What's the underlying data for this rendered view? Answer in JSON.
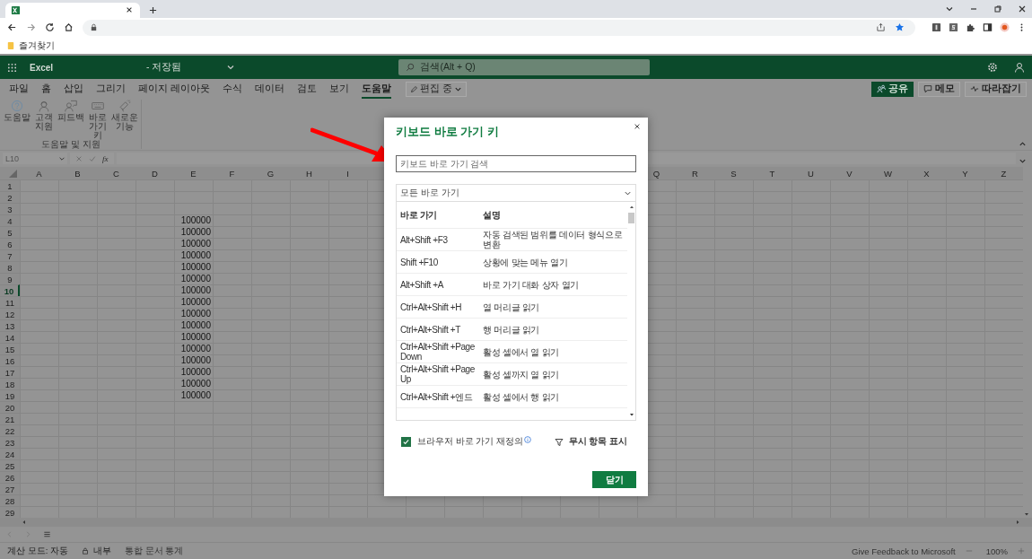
{
  "browser": {
    "bookmark": "즐겨찾기"
  },
  "app_bar": {
    "app_name": "Excel",
    "doc_status": "- 저장됨",
    "search_placeholder": "검색(Alt + Q)"
  },
  "ribbon_tabs": [
    {
      "label": "파일",
      "selected": false
    },
    {
      "label": "홈",
      "selected": false
    },
    {
      "label": "삽입",
      "selected": false
    },
    {
      "label": "그리기",
      "selected": false
    },
    {
      "label": "페이지 레이아웃",
      "selected": false
    },
    {
      "label": "수식",
      "selected": false
    },
    {
      "label": "데이터",
      "selected": false
    },
    {
      "label": "검토",
      "selected": false
    },
    {
      "label": "보기",
      "selected": false
    },
    {
      "label": "도움말",
      "selected": true
    }
  ],
  "editing_button": "편집 중",
  "right_buttons": [
    {
      "label": "공유",
      "kind": "share"
    },
    {
      "label": "메모",
      "kind": "comment"
    },
    {
      "label": "따라잡기",
      "kind": "catchup"
    }
  ],
  "ribbon_group": {
    "label": "도움말 및 지원",
    "buttons": [
      {
        "label": "도움말",
        "kind": "help"
      },
      {
        "label": "고객 지원",
        "kind": "support"
      },
      {
        "label": "피드백",
        "kind": "feedback"
      },
      {
        "label": "바로 가기 키",
        "kind": "keyboard"
      },
      {
        "label": "새로운 기능",
        "kind": "new"
      }
    ]
  },
  "formula_bar": {
    "name_box": "L10",
    "fx": "fx"
  },
  "grid": {
    "columns": [
      "A",
      "B",
      "C",
      "D",
      "E",
      "F",
      "G",
      "H",
      "I",
      "Q",
      "R",
      "S",
      "T",
      "U",
      "V",
      "W",
      "X",
      "Y",
      "Z"
    ],
    "rows": [
      {
        "header": "1",
        "selected": false
      },
      {
        "header": "2",
        "selected": false
      },
      {
        "header": "3",
        "selected": false
      },
      {
        "header": "4",
        "e": "100000",
        "selected": false
      },
      {
        "header": "5",
        "e": "100000",
        "selected": false
      },
      {
        "header": "6",
        "e": "100000",
        "selected": false
      },
      {
        "header": "7",
        "e": "100000",
        "selected": false
      },
      {
        "header": "8",
        "e": "100000",
        "selected": false
      },
      {
        "header": "9",
        "e": "100000",
        "selected": false
      },
      {
        "header": "10",
        "e": "100000",
        "selected": true
      },
      {
        "header": "11",
        "e": "100000",
        "selected": false
      },
      {
        "header": "12",
        "e": "100000",
        "selected": false
      },
      {
        "header": "13",
        "e": "100000",
        "selected": false
      },
      {
        "header": "14",
        "e": "100000",
        "selected": false
      },
      {
        "header": "15",
        "e": "100000",
        "selected": false
      },
      {
        "header": "16",
        "e": "100000",
        "selected": false
      },
      {
        "header": "17",
        "e": "100000",
        "selected": false
      },
      {
        "header": "18",
        "e": "100000",
        "selected": false
      },
      {
        "header": "19",
        "e": "100000",
        "selected": false
      },
      {
        "header": "20",
        "selected": false
      },
      {
        "header": "21",
        "selected": false
      },
      {
        "header": "22",
        "selected": false
      },
      {
        "header": "23",
        "selected": false
      },
      {
        "header": "24",
        "selected": false
      },
      {
        "header": "25",
        "selected": false
      },
      {
        "header": "26",
        "selected": false
      },
      {
        "header": "27",
        "selected": false
      },
      {
        "header": "28",
        "selected": false
      },
      {
        "header": "29",
        "selected": false
      }
    ]
  },
  "status_bar": {
    "calc_mode": "계산 모드: 자동",
    "sensitivity": "내부",
    "workbook_stats": "통합 문서 통계",
    "feedback": "Give Feedback to Microsoft",
    "zoom": "100%"
  },
  "dialog": {
    "title": "키보드 바로 가기 키",
    "search_placeholder": "키보드 바로 가기 검색",
    "filter": "모든 바로 가기",
    "columns": [
      "바로 가기",
      "설명"
    ],
    "rows": [
      {
        "keys": "Alt+Shift +F3",
        "description": "자동 검색된 범위를 데이터 형식으로 변환"
      },
      {
        "keys": "Shift +F10",
        "description": "상황에 맞는 메뉴 열기"
      },
      {
        "keys": "Alt+Shift +A",
        "description": "바로 가기 대화 상자 열기"
      },
      {
        "keys": "Ctrl+Alt+Shift +H",
        "description": "열 머리글 읽기"
      },
      {
        "keys": "Ctrl+Alt+Shift +T",
        "description": "행 머리글 읽기"
      },
      {
        "keys": "Ctrl+Alt+Shift +Page Down",
        "description": "활성 셀에서 열 읽기"
      },
      {
        "keys": "Ctrl+Alt+Shift +Page Up",
        "description": "활성 셀까지 열 읽기"
      },
      {
        "keys": "Ctrl+Alt+Shift +엔드",
        "description": "활성 셀에서 행 읽기"
      }
    ],
    "override": {
      "label": "브라우저 바로 가기 재정의",
      "checked": true
    },
    "show_ignored": "무시 항목 표시",
    "close_button": "닫기"
  }
}
